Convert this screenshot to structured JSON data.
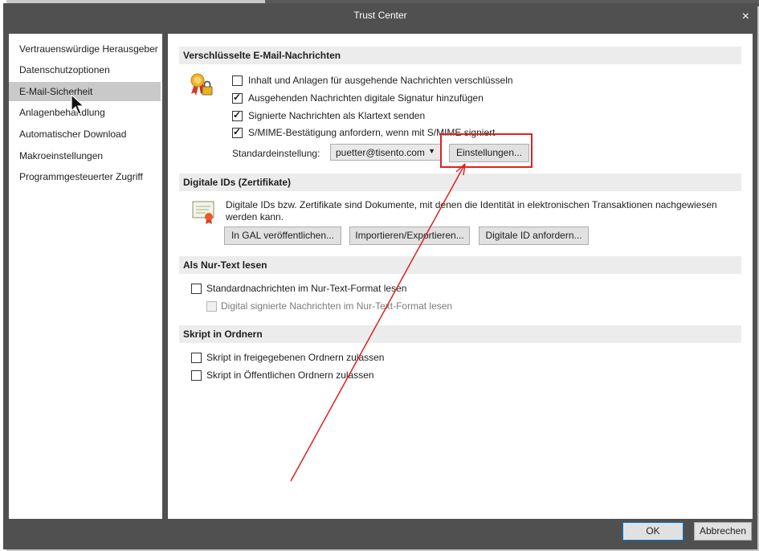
{
  "window": {
    "title": "Trust Center",
    "close_icon": "×"
  },
  "nav": {
    "items": [
      {
        "label": "Vertrauenswürdige Herausgeber"
      },
      {
        "label": "Datenschutzoptionen"
      },
      {
        "label": "E-Mail-Sicherheit"
      },
      {
        "label": "Anlagenbehandlung"
      },
      {
        "label": "Automatischer Download"
      },
      {
        "label": "Makroeinstellungen"
      },
      {
        "label": "Programmgesteuerter Zugriff"
      }
    ],
    "selected_index": 2
  },
  "encrypted": {
    "heading": "Verschlüsselte E-Mail-Nachrichten",
    "options": [
      {
        "label": "Inhalt und Anlagen für ausgehende Nachrichten verschlüsseln",
        "checked": false
      },
      {
        "label": "Ausgehenden Nachrichten digitale Signatur hinzufügen",
        "checked": true
      },
      {
        "label": "Signierte Nachrichten als Klartext senden",
        "checked": true
      },
      {
        "label": "S/MIME-Bestätigung anfordern, wenn mit S/MIME signiert",
        "checked": true
      }
    ],
    "default_label": "Standardeinstellung:",
    "default_value": "puetter@tisento.com",
    "settings_button": "Einstellungen..."
  },
  "digital_ids": {
    "heading": "Digitale IDs (Zertifikate)",
    "description": "Digitale IDs bzw. Zertifikate sind Dokumente, mit denen die Identität in elektronischen Transaktionen nachgewiesen werden kann.",
    "buttons": [
      "In GAL veröffentlichen...",
      "Importieren/Exportieren...",
      "Digitale ID anfordern..."
    ]
  },
  "plaintext": {
    "heading": "Als Nur-Text lesen",
    "options": [
      {
        "label": "Standardnachrichten im Nur-Text-Format lesen",
        "checked": false,
        "disabled": false
      },
      {
        "label": "Digital signierte Nachrichten im Nur-Text-Format lesen",
        "checked": false,
        "disabled": true
      }
    ]
  },
  "folders": {
    "heading": "Skript in Ordnern",
    "options": [
      {
        "label": "Skript in freigegebenen Ordnern zulassen",
        "checked": false
      },
      {
        "label": "Skript in Öffentlichen Ordnern zulassen",
        "checked": false
      }
    ]
  },
  "footer": {
    "ok": "OK",
    "cancel": "Abbrechen"
  },
  "colors": {
    "annotation": "#e02020",
    "selected_nav": "#c9c9c9",
    "dialog_frame": "#505050"
  }
}
